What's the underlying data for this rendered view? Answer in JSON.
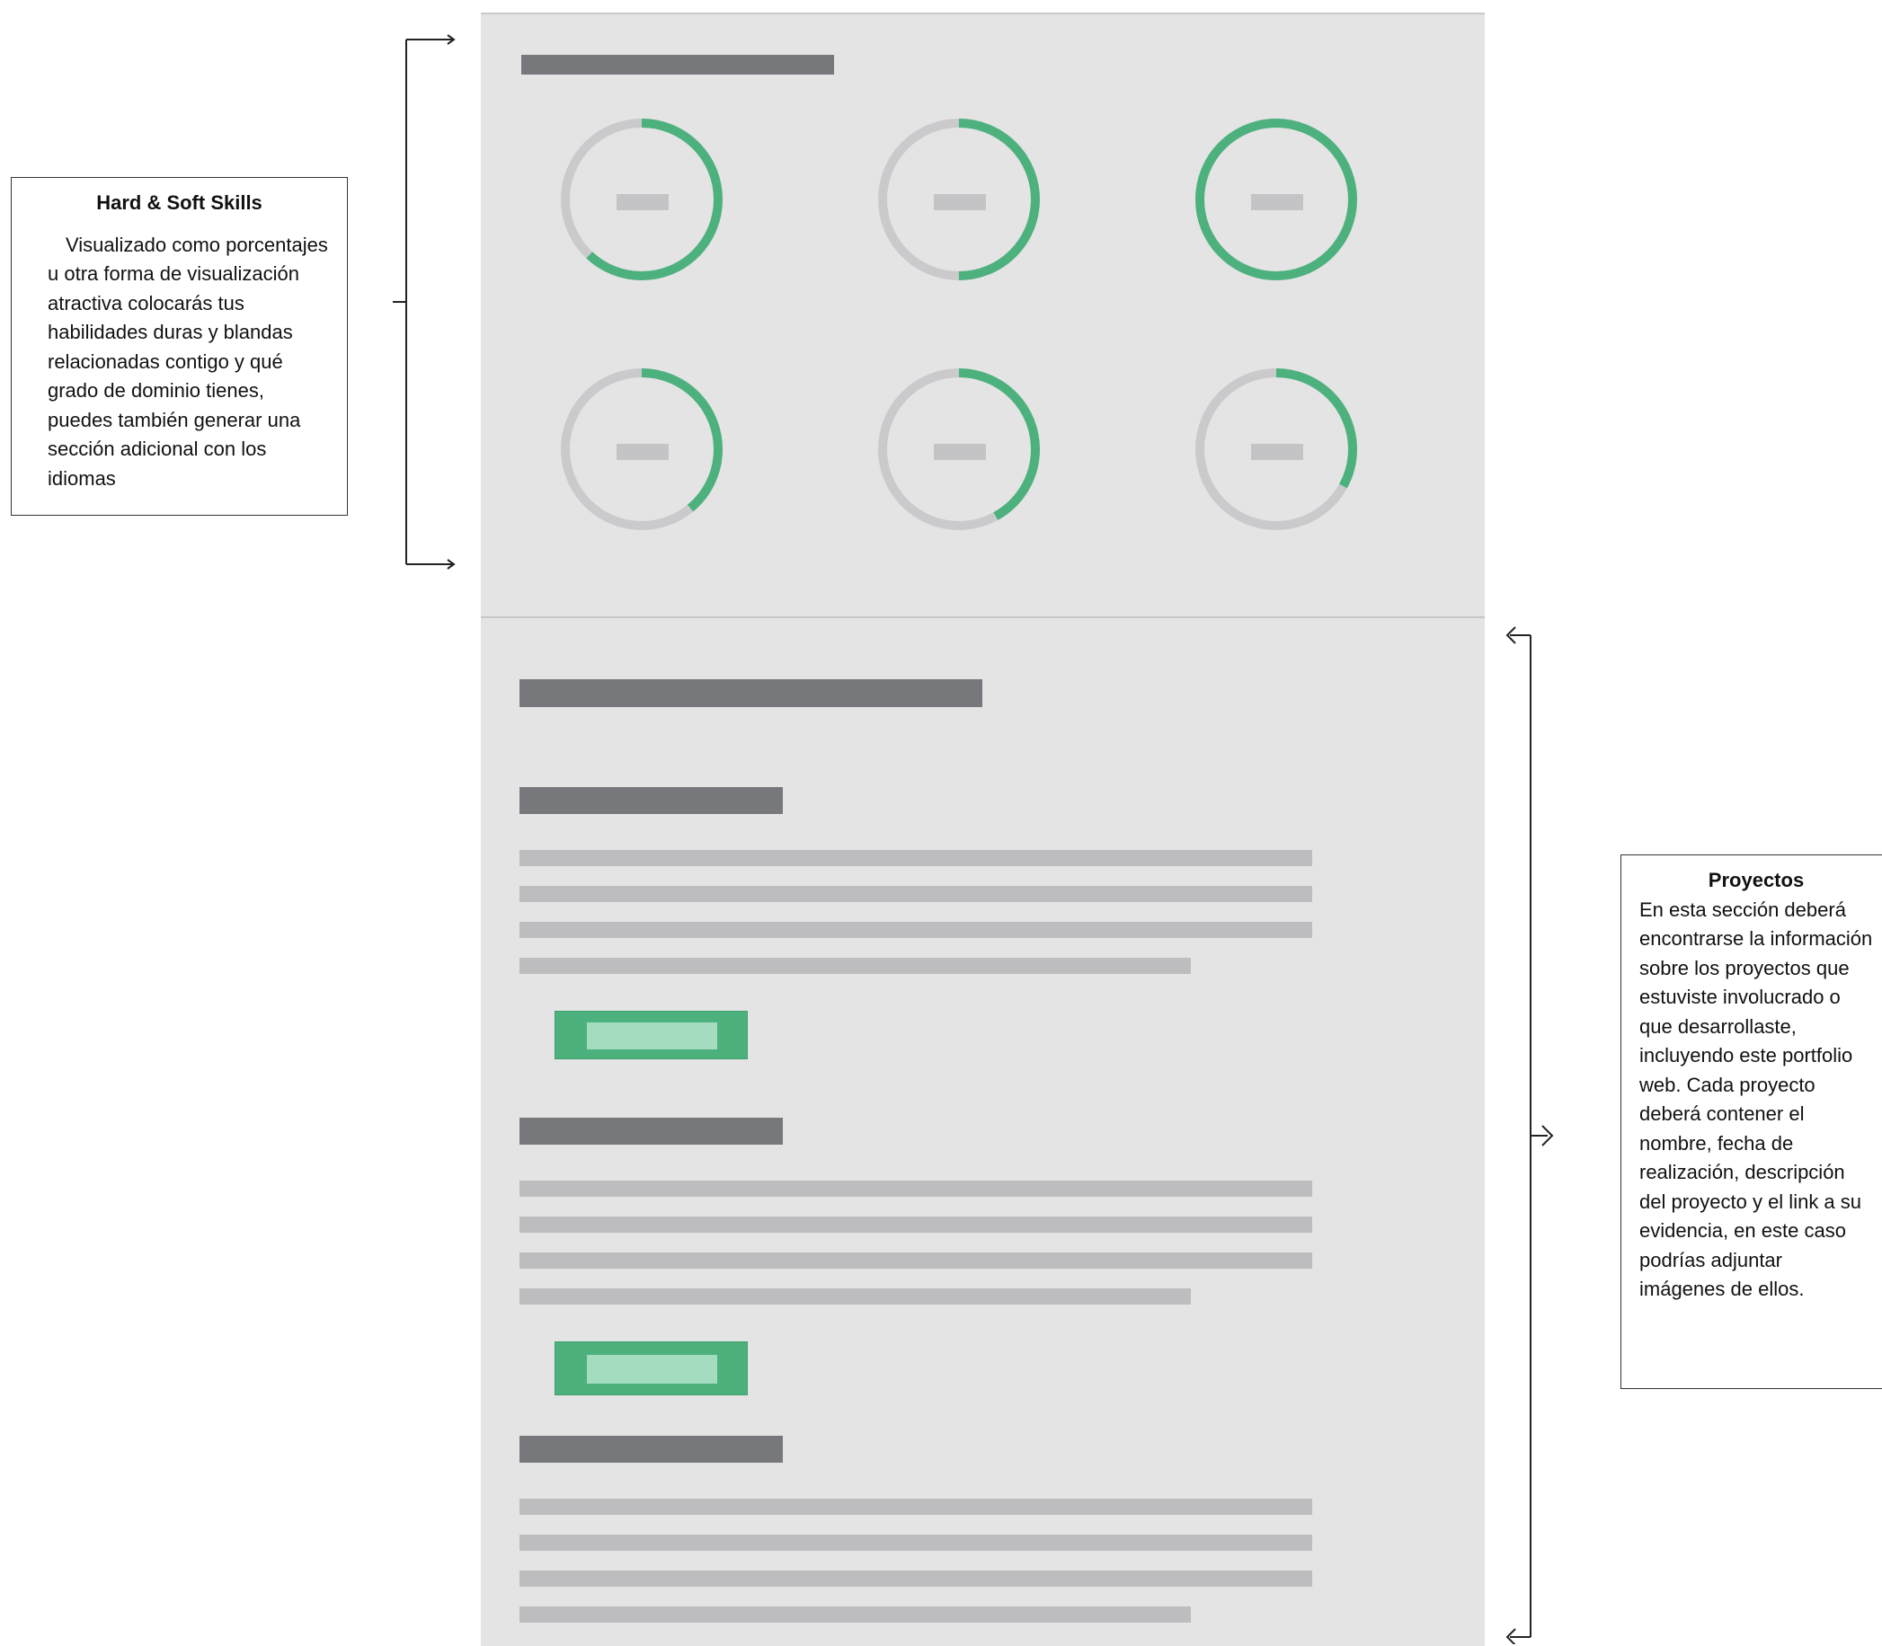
{
  "annotations": {
    "skills": {
      "title": "Hard & Soft Skills",
      "body": "Visualizado como porcentajes u otra forma de visualización atractiva colocarás tus habilidades duras y blandas relacionadas contigo y qué grado de dominio tienes, puedes también generar una sección adicional con los idiomas"
    },
    "projects": {
      "title": "Proyectos",
      "body": "En esta sección deberá encontrarse la información sobre los proyectos que estuviste involucrado o que desarrollaste, incluyendo este portfolio web. Cada proyecto deberá contener el nombre, fecha de realización, descripción del proyecto y el link a su evidencia, en este caso podrías adjuntar imágenes de ellos."
    }
  },
  "skills_rings": [
    0.62,
    0.5,
    1.0,
    0.39,
    0.42,
    0.33
  ],
  "colors": {
    "ring_fill": "#4db17e",
    "ring_track": "#cacacd",
    "panel": "#e4e4e5",
    "heading_bar": "#77787c",
    "text_bar": "#bdbdbf"
  }
}
